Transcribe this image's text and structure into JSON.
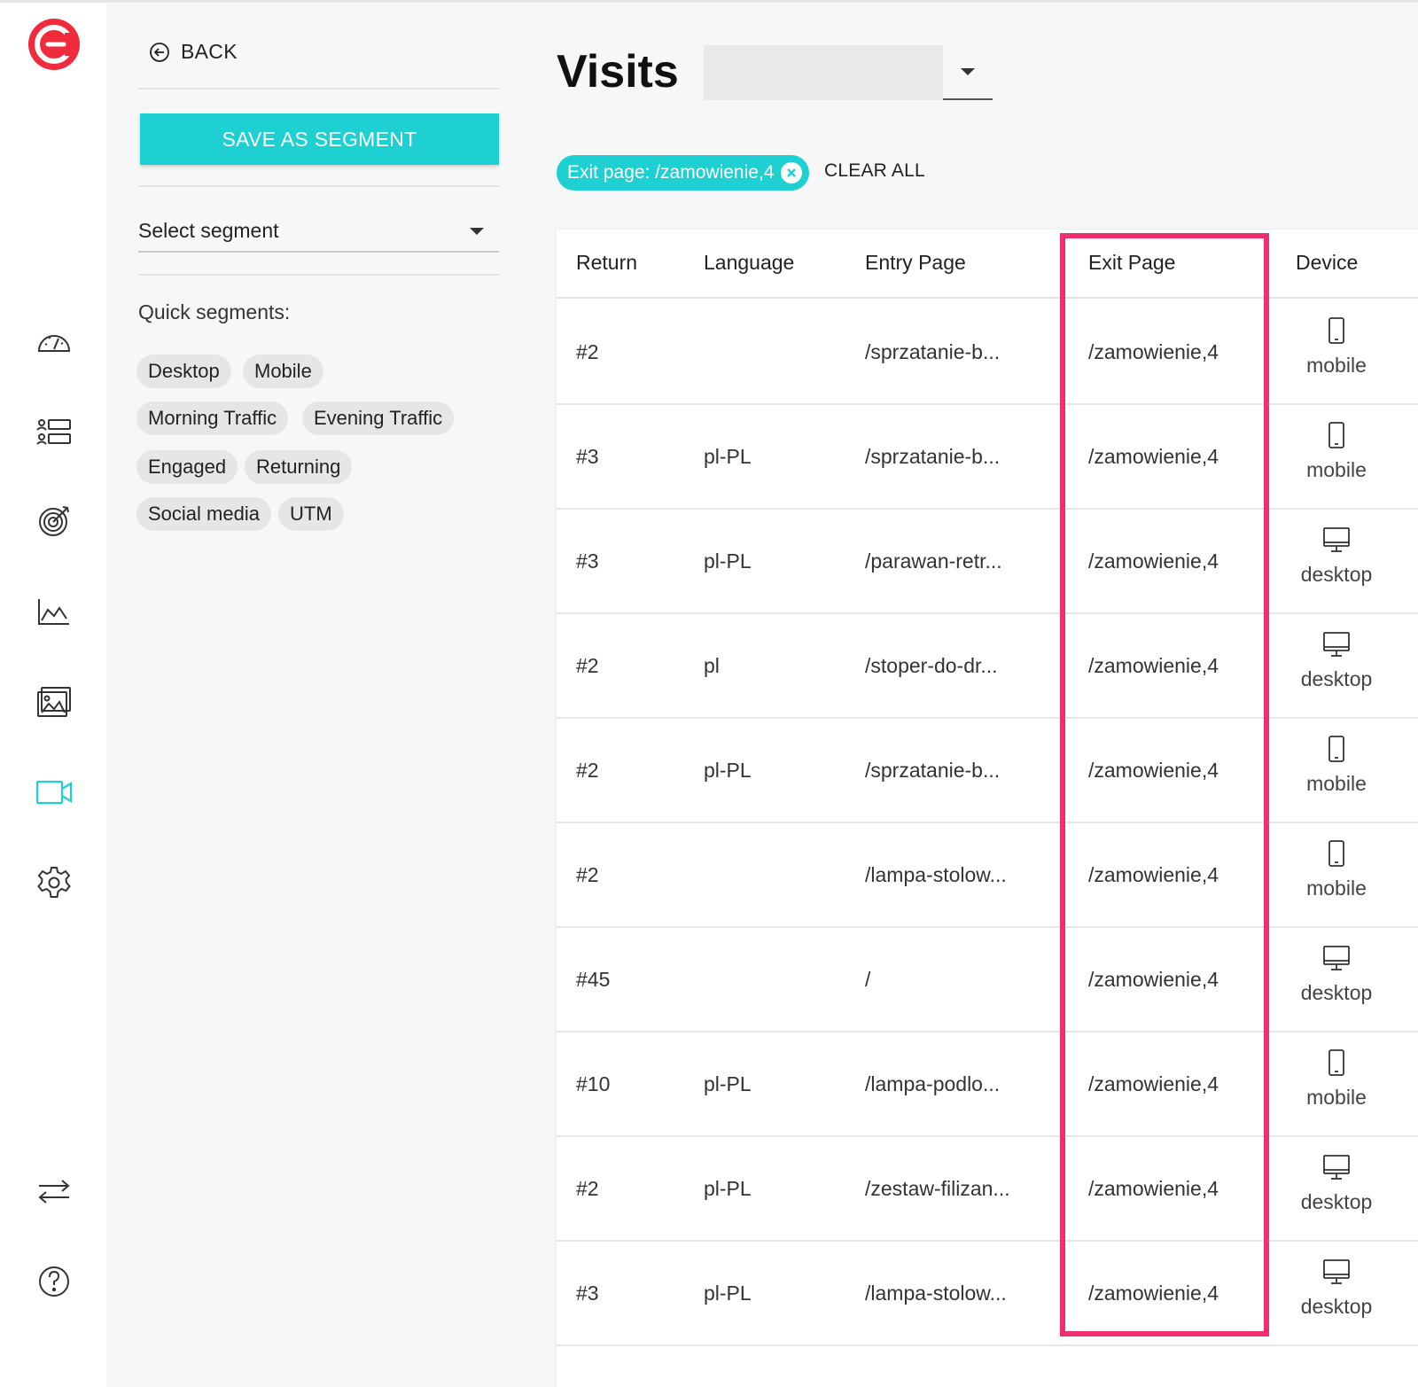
{
  "sidebar": {
    "colors": {
      "logo": "#f02c3c",
      "active": "#1fd0d2",
      "icon": "#333333"
    }
  },
  "panel": {
    "back_label": "BACK",
    "save_label": "SAVE AS SEGMENT",
    "select_label": "Select segment",
    "quick_label": "Quick segments:",
    "chips": [
      "Desktop",
      "Mobile",
      "Morning Traffic",
      "Evening Traffic",
      "Engaged",
      "Returning",
      "Social media",
      "UTM"
    ]
  },
  "main": {
    "title": "Visits",
    "filter_chip": "Exit page: /zamowienie,4",
    "clear_all": "CLEAR ALL",
    "columns": [
      "Return",
      "Language",
      "Entry Page",
      "Exit Page",
      "Device"
    ],
    "rows": [
      {
        "return": "#2",
        "language": "",
        "entry": "/sprzatanie-b...",
        "exit": "/zamowienie,4",
        "device": "mobile"
      },
      {
        "return": "#3",
        "language": "pl-PL",
        "entry": "/sprzatanie-b...",
        "exit": "/zamowienie,4",
        "device": "mobile"
      },
      {
        "return": "#3",
        "language": "pl-PL",
        "entry": "/parawan-retr...",
        "exit": "/zamowienie,4",
        "device": "desktop"
      },
      {
        "return": "#2",
        "language": "pl",
        "entry": "/stoper-do-dr...",
        "exit": "/zamowienie,4",
        "device": "desktop"
      },
      {
        "return": "#2",
        "language": "pl-PL",
        "entry": "/sprzatanie-b...",
        "exit": "/zamowienie,4",
        "device": "mobile"
      },
      {
        "return": "#2",
        "language": "",
        "entry": "/lampa-stolow...",
        "exit": "/zamowienie,4",
        "device": "mobile"
      },
      {
        "return": "#45",
        "language": "",
        "entry": "/",
        "exit": "/zamowienie,4",
        "device": "desktop"
      },
      {
        "return": "#10",
        "language": "pl-PL",
        "entry": "/lampa-podlo...",
        "exit": "/zamowienie,4",
        "device": "mobile"
      },
      {
        "return": "#2",
        "language": "pl-PL",
        "entry": "/zestaw-filizan...",
        "exit": "/zamowienie,4",
        "device": "desktop"
      },
      {
        "return": "#3",
        "language": "pl-PL",
        "entry": "/lampa-stolow...",
        "exit": "/zamowienie,4",
        "device": "desktop"
      }
    ],
    "highlight_color": "#f0306e",
    "accent_color": "#1fd0d2"
  }
}
